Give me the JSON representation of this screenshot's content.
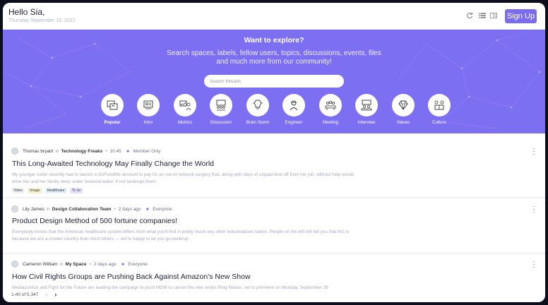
{
  "header": {
    "greeting": "Hello Sia,",
    "date": "Thursday September 10, 2022",
    "signup_label": "Sign Up"
  },
  "hero": {
    "title": "Want to explore?",
    "subtitle_line1": "Search spaces, labels, fellow users, topics, discussions, events, files",
    "subtitle_line2": "and much more from our community!",
    "search_placeholder": "Search threads"
  },
  "categories": [
    {
      "label": "Popular",
      "icon": "popular-icon",
      "active": true
    },
    {
      "label": "Intro",
      "icon": "intro-icon"
    },
    {
      "label": "Metrics",
      "icon": "metrics-icon"
    },
    {
      "label": "Discussion",
      "icon": "discussion-icon"
    },
    {
      "label": "Brain Storm",
      "icon": "brainstorm-icon"
    },
    {
      "label": "Engineer",
      "icon": "engineer-icon"
    },
    {
      "label": "Meeting",
      "icon": "meeting-icon"
    },
    {
      "label": "Interview",
      "icon": "interview-icon"
    },
    {
      "label": "Values",
      "icon": "diamond-icon"
    },
    {
      "label": "Culture",
      "icon": "culture-icon"
    }
  ],
  "posts": [
    {
      "author": "Thomas bryant",
      "in": "in",
      "space": "Technology Freaks",
      "time": "10.45",
      "audience": "Member Only",
      "title": "This Long-Awaited Technology May Finally Change the World",
      "body": "My younger sister recently had to launch a GoFundMe account to pay for an out-of-network surgery that, along with days of unpaid time off from her job, without help would drive her and her family deep under financial water, if not bankrupt them.",
      "tags": [
        {
          "label": "Video",
          "color": "#f1f2f6",
          "text": "#444"
        },
        {
          "label": "Image",
          "color": "#f6f3d2",
          "text": "#444"
        },
        {
          "label": "Healthcare",
          "color": "#e4f1f7",
          "text": "#335"
        },
        {
          "label": "To do",
          "color": "#e6e2fb",
          "text": "#556"
        }
      ]
    },
    {
      "author": "Lily James",
      "in": "in",
      "space": "Design Collaboration Team",
      "time": "2 days ago",
      "audience": "Everyone",
      "title": "Product Design Method of 500 fortune companies!",
      "body": "Everybody knows that the American healthcare system differs from what you'll find in pretty much any other industrialized nation. People on the left will tell you that this is because we are a crueler country than most others — we're happy to let you go bankrup"
    },
    {
      "author": "Cameron William",
      "in": "in",
      "space": "My Space",
      "time": "2 days ago",
      "audience": "Everyone",
      "title": "How Civil Rights Groups are Pushing Back Against Amazon's New Show",
      "body": "MediaJustice and Fight for the Future are leading the campaign to push MGM to cancel the new series Ring Nation, set to premiere on Monday, September 26"
    }
  ],
  "pager": {
    "range": "1-40 of 5,347",
    "prev": "‹",
    "next": "›"
  },
  "colors": {
    "accent": "#7a6cf0",
    "hero": "#7d6ff2"
  }
}
